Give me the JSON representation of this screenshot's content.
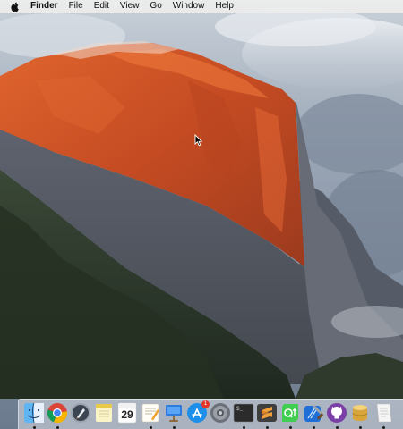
{
  "menubar": {
    "apple_icon": "apple-icon",
    "app_name": "Finder",
    "items": [
      "File",
      "Edit",
      "View",
      "Go",
      "Window",
      "Help"
    ]
  },
  "desktop": {
    "wallpaper": "mountain-cliff-sunset-icon"
  },
  "dock": {
    "items": [
      {
        "icon": "finder-icon",
        "running": true
      },
      {
        "icon": "chrome-icon",
        "running": true
      },
      {
        "icon": "launchpad-icon",
        "running": false
      },
      {
        "icon": "notes-icon",
        "running": false
      },
      {
        "icon": "calendar-icon",
        "running": false,
        "day": "29"
      },
      {
        "icon": "pages-icon",
        "running": true
      },
      {
        "icon": "keynote-icon",
        "running": true
      },
      {
        "icon": "app-store-icon",
        "running": false,
        "badge": "1"
      },
      {
        "icon": "system-preferences-icon",
        "running": false
      },
      {
        "icon": "terminal-icon",
        "running": true,
        "text": "$_"
      },
      {
        "icon": "sublime-text-icon",
        "running": true
      },
      {
        "icon": "qt-creator-icon",
        "running": true
      },
      {
        "icon": "xcode-icon",
        "running": true
      },
      {
        "icon": "github-icon",
        "running": true
      },
      {
        "icon": "sequel-icon",
        "running": true
      },
      {
        "icon": "textedit-icon",
        "running": true
      }
    ]
  },
  "colors": {
    "menubar_bg": "#ececec",
    "cliff_glow": "#d9562a",
    "sky": "#8a97a8",
    "forest": "#2d3a2b"
  }
}
